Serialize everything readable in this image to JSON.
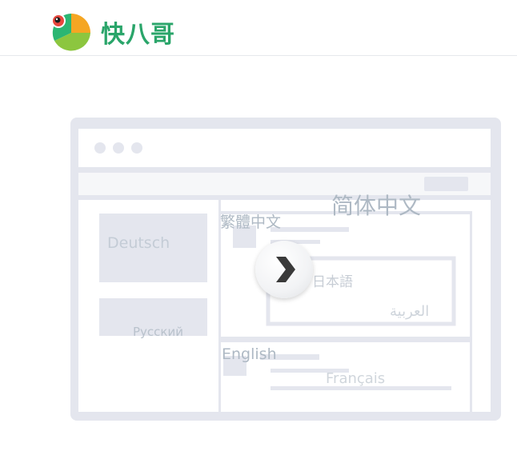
{
  "header": {
    "brand_name": "快八哥",
    "logo_icon": "parrot-logo-icon"
  },
  "illustration": {
    "play_icon": "chevron-right-icon",
    "languages": {
      "simplified_chinese": "简体中文",
      "traditional_chinese": "繁體中文",
      "german": "Deutsch",
      "japanese": "日本語",
      "arabic": "العربية",
      "russian": "Русский",
      "english": "English",
      "french": "Français"
    }
  },
  "colors": {
    "brand_green": "#2aa56a",
    "wireframe_gray": "#e4e6ee",
    "language_text": "#aeb9c4"
  }
}
